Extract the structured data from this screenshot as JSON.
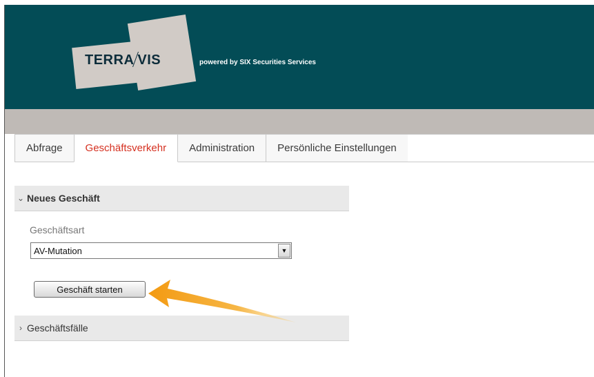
{
  "brand": {
    "logo_left": "TERRA",
    "logo_right": "VIS",
    "tagline": "powered by SIX Securities Services"
  },
  "tabs": [
    {
      "label": "Abfrage",
      "active": false
    },
    {
      "label": "Geschäftsverkehr",
      "active": true
    },
    {
      "label": "Administration",
      "active": false
    },
    {
      "label": "Persönliche Einstellungen",
      "active": false
    }
  ],
  "new_business": {
    "header": "Neues Geschäft",
    "expanded": true,
    "field_label": "Geschäftsart",
    "selected_value": "AV-Mutation",
    "start_button": "Geschäft starten"
  },
  "cases": {
    "header": "Geschäftsfälle",
    "expanded": false
  },
  "colors": {
    "header_bg": "#034c56",
    "active_tab": "#d53020",
    "annotation_arrow": "#f6a623"
  }
}
